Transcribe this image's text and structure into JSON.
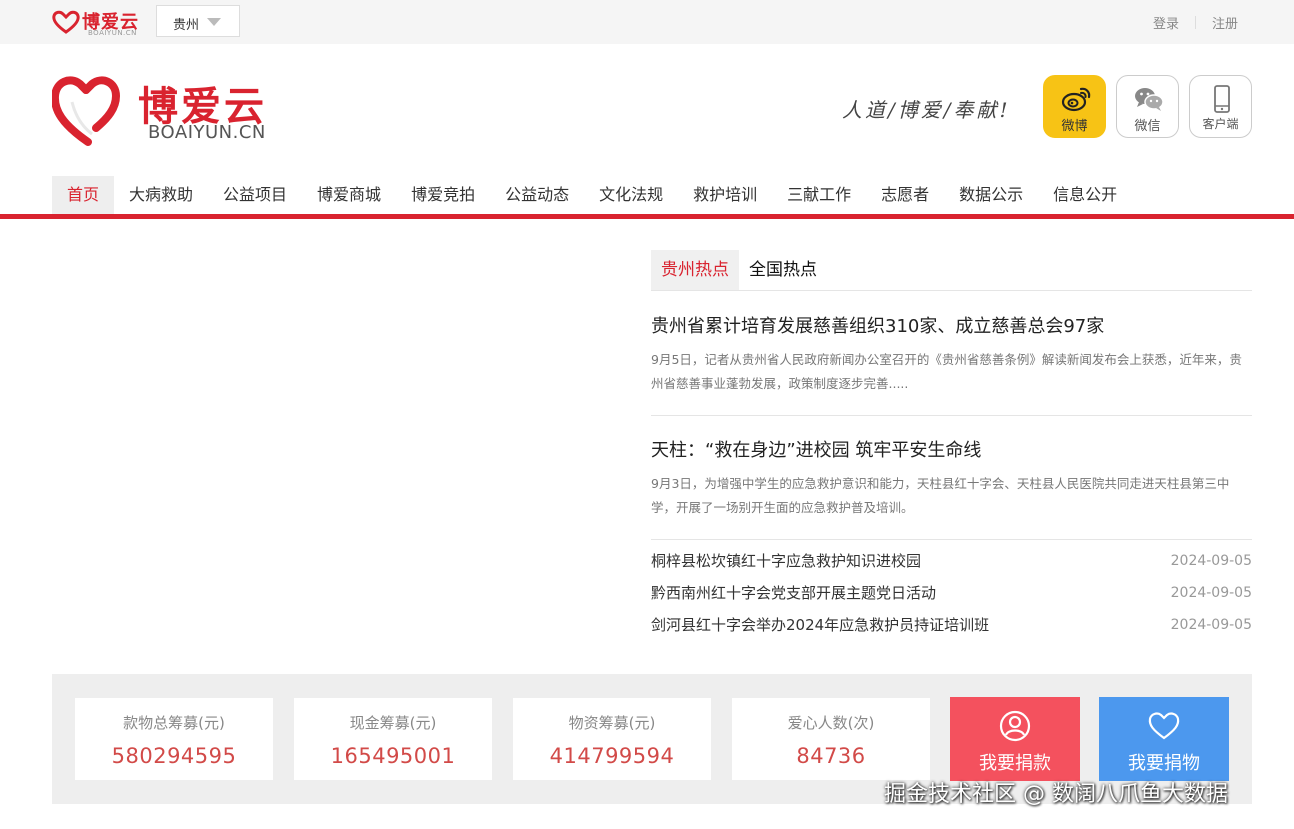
{
  "topbar": {
    "logo_text": "博爱云",
    "logo_sub": "BOAIYUN.CN",
    "city": "贵州",
    "login": "登录",
    "register": "注册"
  },
  "header": {
    "logo_text": "博爱云",
    "logo_sub": "BOAIYUN.CN",
    "slogan": "人道/博爱/奉献!",
    "social": [
      {
        "label": "微博",
        "icon": "weibo-icon"
      },
      {
        "label": "微信",
        "icon": "wechat-icon"
      },
      {
        "label": "客户端",
        "icon": "phone-icon"
      }
    ]
  },
  "nav": {
    "items": [
      "首页",
      "大病救助",
      "公益项目",
      "博爱商城",
      "博爱竞拍",
      "公益动态",
      "文化法规",
      "救护培训",
      "三献工作",
      "志愿者",
      "数据公示",
      "信息公开"
    ],
    "active": "首页"
  },
  "news": {
    "tabs": [
      "贵州热点",
      "全国热点"
    ],
    "active_tab": "贵州热点",
    "featured": [
      {
        "title": "贵州省累计培育发展慈善组织310家、成立慈善总会97家",
        "summary": "9月5日，记者从贵州省人民政府新闻办公室召开的《贵州省慈善条例》解读新闻发布会上获悉，近年来，贵州省慈善事业蓬勃发展，政策制度逐步完善....."
      },
      {
        "title": "天柱：“救在身边”进校园 筑牢平安生命线",
        "summary": "9月3日，为增强中学生的应急救护意识和能力，天柱县红十字会、天柱县人民医院共同走进天柱县第三中学，开展了一场别开生面的应急救护普及培训。"
      }
    ],
    "list": [
      {
        "title": "桐梓县松坎镇红十字应急救护知识进校园",
        "date": "2024-09-05"
      },
      {
        "title": "黔西南州红十字会党支部开展主题党日活动",
        "date": "2024-09-05"
      },
      {
        "title": "剑河县红十字会举办2024年应急救护员持证培训班",
        "date": "2024-09-05"
      }
    ]
  },
  "stats": [
    {
      "label": "款物总筹募(元)",
      "value": "580294595"
    },
    {
      "label": "现金筹募(元)",
      "value": "165495001"
    },
    {
      "label": "物资筹募(元)",
      "value": "414799594"
    },
    {
      "label": "爱心人数(次)",
      "value": "84736"
    }
  ],
  "actions": {
    "donate_money": "我要捐款",
    "donate_goods": "我要捐物"
  },
  "watermark": "掘金技术社区 @ 数阔八爪鱼大数据",
  "colors": {
    "brand_red": "#d9232f",
    "weibo_yellow": "#f7c315",
    "donate_money": "#f4515e",
    "donate_goods": "#4c98ee",
    "stat_value": "#d24a48"
  }
}
